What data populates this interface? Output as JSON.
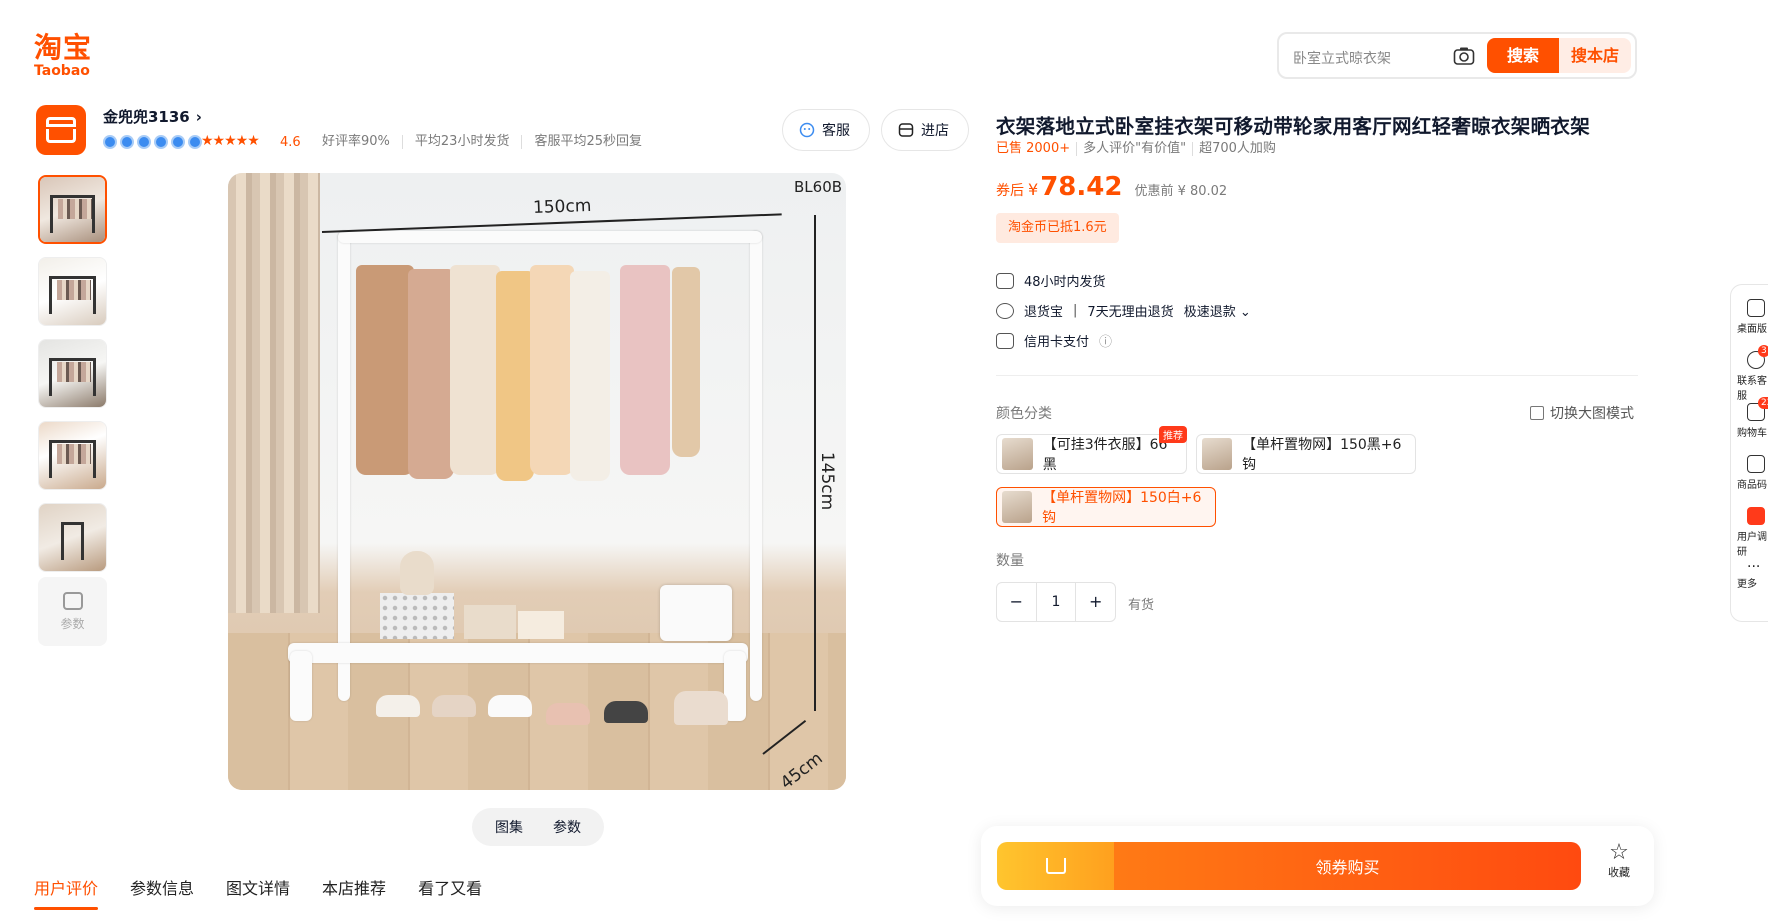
{
  "header": {
    "logo_cn": "淘宝",
    "logo_en": "Taobao",
    "search_placeholder": "卧室立式晾衣架",
    "search_button": "搜索",
    "search_store_button": "搜本店"
  },
  "shop": {
    "name": "金兜兜3136",
    "rating": "4.6",
    "metrics": [
      "好评率90%",
      "平均23小时发货",
      "客服平均25秒回复"
    ],
    "service_button": "客服",
    "enter_shop_button": "进店"
  },
  "gallery": {
    "thumb_count": 5,
    "params_thumb_label": "参数",
    "main_image_labels": {
      "model": "BL60B",
      "width": "150cm",
      "height": "145cm",
      "depth": "45cm"
    },
    "toggle": [
      "图集",
      "参数"
    ]
  },
  "bottom_tabs": [
    "用户评价",
    "参数信息",
    "图文详情",
    "本店推荐",
    "看了又看"
  ],
  "product": {
    "title": "衣架落地立式卧室挂衣架可移动带轮家用客厅网红轻奢晾衣架晒衣架",
    "sold": "已售 2000+",
    "review_note": "多人评价\"有价值\"",
    "cart_note": "超700人加购",
    "price_label": "券后",
    "currency": "¥",
    "price": "78.42",
    "original_price": "优惠前 ¥ 80.02",
    "coin_note": "淘金币已抵1.6元",
    "services": {
      "shipping": "48小时内发货",
      "return_label": "退货宝",
      "return_policy": "7天无理由退货",
      "refund": "极速退款",
      "payment": "信用卡支付"
    },
    "color_label": "颜色分类",
    "switch_mode": "切换大图模式",
    "skus": [
      {
        "label": "【可挂3件衣服】66黑",
        "badge": "推荐"
      },
      {
        "label": "【单杆置物网】150黑+6钩"
      },
      {
        "label": "【单杆置物网】150白+6钩"
      }
    ],
    "quantity_label": "数量",
    "quantity": "1",
    "stock": "有货"
  },
  "buybar": {
    "buy_label": "领券购买",
    "favorite_label": "收藏"
  },
  "float_sidebar": {
    "items": [
      "桌面版",
      "联系客服",
      "购物车",
      "商品码",
      "用户调研",
      "更多"
    ],
    "service_badge": "3",
    "cart_badge": "22"
  },
  "colors": {
    "accent": "#ff5000"
  }
}
